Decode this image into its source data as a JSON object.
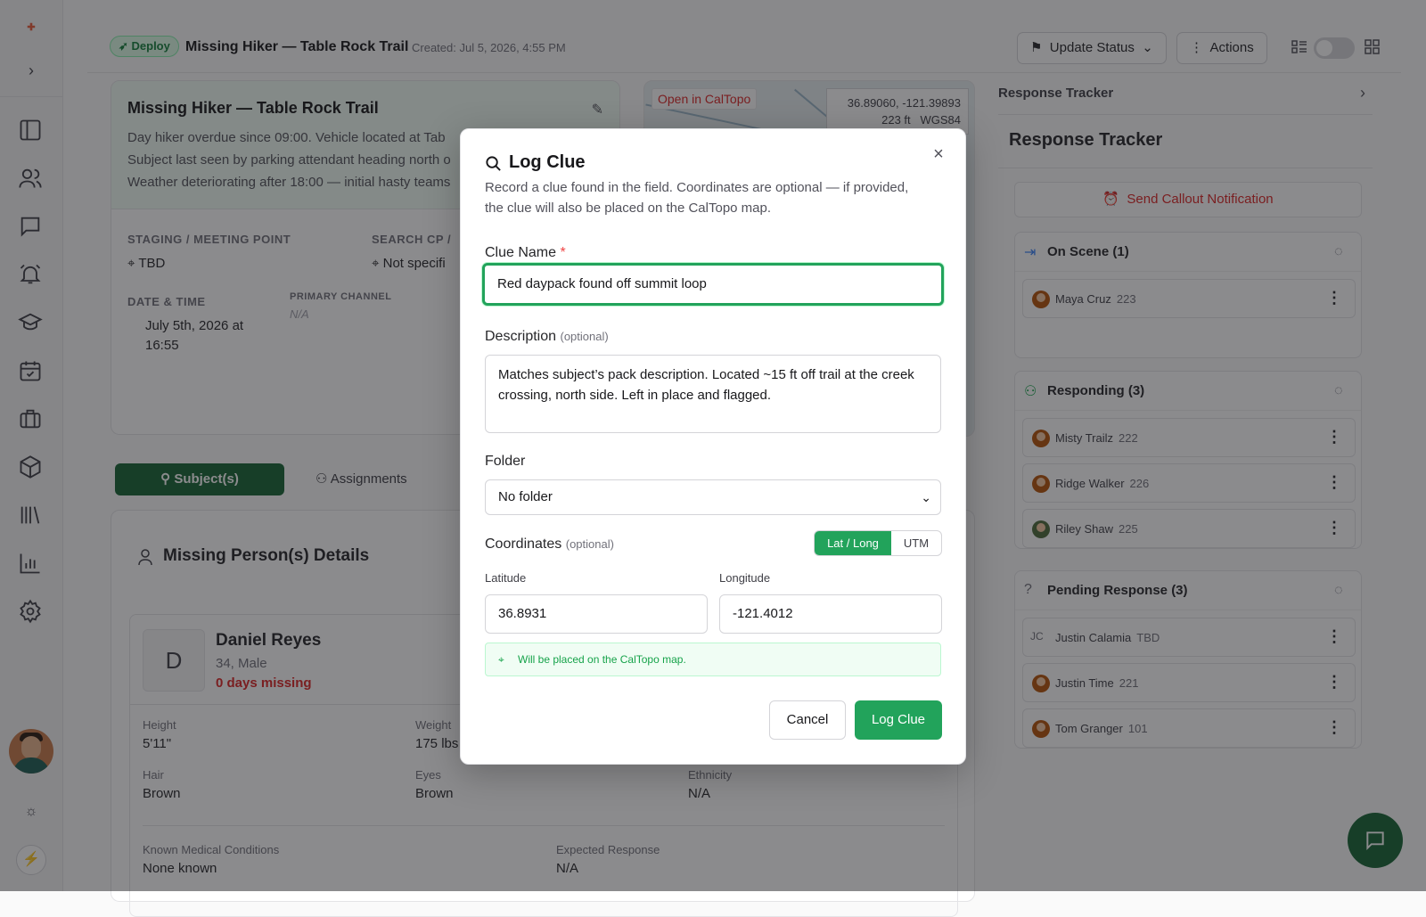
{
  "colors": {
    "accent": "#22a35b",
    "danger": "#dc2626",
    "dark_green": "#166534"
  },
  "topbar": {
    "badge": "Deploy",
    "title": "Missing Hiker — Table Rock Trail",
    "created": "Created: Jul 5, 2026, 4:55 PM",
    "update_status": "Update Status",
    "actions": "Actions"
  },
  "incident": {
    "title": "Missing Hiker — Table Rock Trail",
    "desc_1": "Day hiker overdue since 09:00. Vehicle located at Tab",
    "desc_2": "Subject last seen by parking attendant heading north o",
    "desc_3": "Weather deteriorating after 18:00 — initial hasty teams",
    "staging_label": "STAGING / MEETING POINT",
    "staging_value": "TBD",
    "search_cp_label": "SEARCH CP /",
    "search_cp_value": "Not specifi",
    "datetime_label": "DATE & TIME",
    "datetime_value_1": "July 5th, 2026 at",
    "datetime_value_2": "16:55",
    "channel_label": "PRIMARY CHANNEL",
    "channel_value": "N/A"
  },
  "map": {
    "open_link": "Open in CalTopo",
    "coords": "36.89060, -121.39893",
    "elev": "223 ft",
    "datum": "WGS84"
  },
  "tabs": {
    "subjects": "Subject(s)",
    "assignments": "Assignments"
  },
  "person": {
    "section_title": "Missing Person(s) Details",
    "initial": "D",
    "name": "Daniel Reyes",
    "meta": "34, Male",
    "missing": "0 days missing",
    "height_label": "Height",
    "height": "5'11\"",
    "weight_label": "Weight",
    "weight": "175 lbs",
    "hair_label": "Hair",
    "hair": "Brown",
    "eyes_label": "Eyes",
    "eyes": "Brown",
    "ethnicity_label": "Ethnicity",
    "ethnicity": "N/A",
    "medical_label": "Known Medical Conditions",
    "medical": "None known",
    "expected_label": "Expected Response",
    "expected": "N/A"
  },
  "tracker": {
    "header": "Response Tracker",
    "title": "Response Tracker",
    "callout": "Send Callout Notification",
    "on_scene": {
      "title": "On Scene (1)",
      "members": [
        {
          "name": "Maya Cruz",
          "num": "223"
        }
      ]
    },
    "responding": {
      "title": "Responding (3)",
      "members": [
        {
          "name": "Misty Trailz",
          "num": "222"
        },
        {
          "name": "Ridge Walker",
          "num": "226"
        },
        {
          "name": "Riley Shaw",
          "num": "225"
        }
      ]
    },
    "pending": {
      "title": "Pending Response (3)",
      "members": [
        {
          "name": "Justin Calamia",
          "num": "TBD",
          "initials": "JC"
        },
        {
          "name": "Justin Time",
          "num": "221"
        },
        {
          "name": "Tom Granger",
          "num": "101"
        }
      ]
    }
  },
  "modal": {
    "title": "Log Clue",
    "description": "Record a clue found in the field. Coordinates are optional — if provided, the clue will also be placed on the CalTopo map.",
    "clue_name_label": "Clue Name",
    "required_mark": "*",
    "clue_name_value": "Red daypack found off summit loop",
    "description_label": "Description",
    "optional_tag": "(optional)",
    "description_value": "Matches subject’s pack description. Located ~15 ft off trail at the creek crossing, north side. Left in place and flagged.",
    "folder_label": "Folder",
    "folder_value": "No folder",
    "coordinates_label": "Coordinates",
    "coord_mode_latlong": "Lat / Long",
    "coord_mode_utm": "UTM",
    "latitude_label": "Latitude",
    "latitude_value": "36.8931",
    "longitude_label": "Longitude",
    "longitude_value": "-121.4012",
    "map_note": "Will be placed on the CalTopo map.",
    "cancel": "Cancel",
    "submit": "Log Clue"
  }
}
